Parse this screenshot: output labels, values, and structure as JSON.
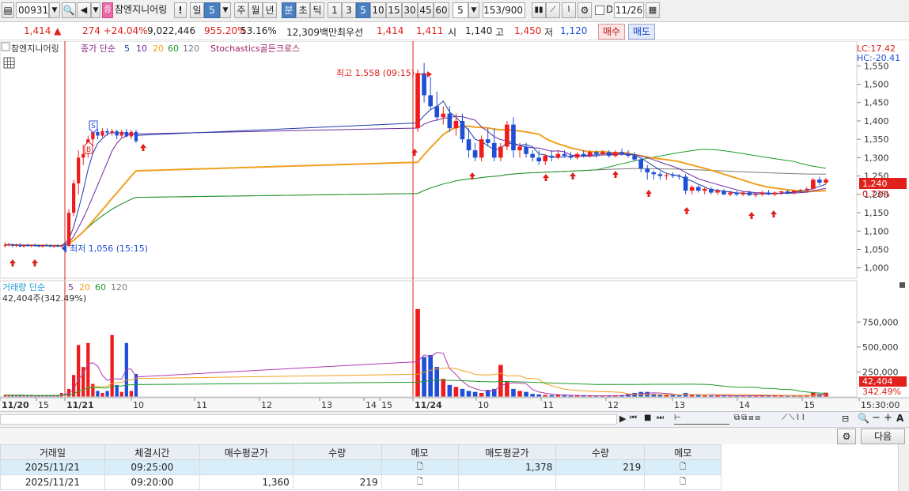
{
  "toolbar": {
    "code": "009310",
    "name": "참엔지니어링",
    "periods": [
      "일",
      "5",
      "주",
      "월",
      "년",
      "분",
      "초",
      "틱"
    ],
    "minutes": [
      "1",
      "3",
      "5",
      "10",
      "15",
      "30",
      "45",
      "60"
    ],
    "selected_minute": "5",
    "interval_value": "5",
    "count": "153",
    "count_total": "/900",
    "date": "11/26",
    "date_label": "D"
  },
  "quote": {
    "price": "1,414 ▲",
    "change": "274 +24.04%",
    "volume": "9,022,446",
    "vol_ratio": "955.20%",
    "turnover_ratio": "53.16%",
    "amount": "12,309백만",
    "best_label": "최우선",
    "ask": "1,414",
    "bid": "1,411",
    "open_label": "시",
    "open": "1,140",
    "high_label": "고",
    "high": "1,450",
    "low_label": "저",
    "low": "1,120",
    "buy_btn": "매수",
    "sell_btn": "매도"
  },
  "chart_legend": {
    "name": "참엔지니어링",
    "ma_label": "종가 단순",
    "ma": [
      "5",
      "10",
      "20",
      "60",
      "120"
    ],
    "signal": "Stochastics골든크로스",
    "lc": "LC:17.42",
    "hc": "HC:-20.41"
  },
  "chart_annotations": {
    "high": "최고 1,558 (09:15)",
    "low": "최저 1,056 (15:15)",
    "cur_price": "1,240",
    "cur_pct": "0.73%"
  },
  "vol_legend": {
    "label": "거래량 단순",
    "ma": [
      "5",
      "20",
      "60",
      "120"
    ],
    "current": "42,404주(342.49%)",
    "cur_val": "42,404",
    "cur_pct": "342.49%"
  },
  "colors": {
    "up": "#ee1c1c",
    "down": "#1f4fd6",
    "ma5": "#1b3fa8",
    "ma10": "#6b2aa0",
    "ma20": "#f0a020",
    "ma60": "#1f9a2a",
    "ma120": "#7a7a7a"
  },
  "chart_data": {
    "type": "candlestick",
    "price_axis": [
      "1,550",
      "1,500",
      "1,450",
      "1,400",
      "1,350",
      "1,300",
      "1,250",
      "1,200",
      "1,150",
      "1,100",
      "1,050",
      "1,000"
    ],
    "volume_axis": [
      "750,000",
      "500,000",
      "250,000"
    ],
    "time_axis": [
      "11/20",
      "15",
      "11/21",
      "10",
      "11",
      "12",
      "13",
      "14",
      "15",
      "11/24",
      "10",
      "11",
      "12",
      "13",
      "14",
      "15",
      "15:30:00"
    ],
    "ylim": [
      980,
      1570
    ],
    "vol_ylim": [
      0,
      950000
    ],
    "sessions": [
      {
        "date": "11/20",
        "bars": [
          [
            1060,
            1070,
            1055,
            1062,
            20000
          ],
          [
            1062,
            1068,
            1058,
            1064,
            15000
          ],
          [
            1064,
            1066,
            1056,
            1060,
            18000
          ],
          [
            1060,
            1066,
            1056,
            1062,
            12000
          ],
          [
            1062,
            1068,
            1056,
            1058,
            22000
          ],
          [
            1058,
            1064,
            1055,
            1062,
            14000
          ],
          [
            1062,
            1066,
            1058,
            1060,
            12000
          ],
          [
            1060,
            1064,
            1056,
            1062,
            15000
          ],
          [
            1062,
            1066,
            1058,
            1060,
            10000
          ],
          [
            1060,
            1064,
            1056,
            1058,
            12000
          ],
          [
            1058,
            1064,
            1055,
            1062,
            15000
          ],
          [
            1062,
            1066,
            1058,
            1060,
            14000
          ],
          [
            1060,
            1064,
            1056,
            1058,
            12000
          ],
          [
            1058,
            1062,
            1054,
            1060,
            15000
          ],
          [
            1060,
            1064,
            1056,
            1058,
            20000
          ],
          [
            1058,
            1062,
            1056,
            1060,
            40000
          ]
        ]
      },
      {
        "date": "11/21",
        "bars": [
          [
            1060,
            1160,
            1056,
            1150,
            80000
          ],
          [
            1150,
            1240,
            1140,
            1230,
            220000
          ],
          [
            1230,
            1320,
            1200,
            1300,
            520000
          ],
          [
            1300,
            1335,
            1280,
            1310,
            300000
          ],
          [
            1310,
            1360,
            1300,
            1350,
            540000
          ],
          [
            1350,
            1375,
            1330,
            1370,
            130000
          ],
          [
            1370,
            1378,
            1350,
            1360,
            60000
          ],
          [
            1360,
            1380,
            1355,
            1372,
            40000
          ],
          [
            1372,
            1380,
            1360,
            1368,
            60000
          ],
          [
            1368,
            1378,
            1360,
            1372,
            620000
          ],
          [
            1372,
            1376,
            1350,
            1360,
            120000
          ],
          [
            1360,
            1376,
            1355,
            1370,
            50000
          ],
          [
            1370,
            1378,
            1355,
            1358,
            540000
          ],
          [
            1358,
            1376,
            1350,
            1370,
            60000
          ],
          [
            1370,
            1376,
            1340,
            1345,
            230000
          ]
        ]
      },
      {
        "date": "11/24",
        "bars": [
          [
            1380,
            1540,
            1370,
            1530,
            880000
          ],
          [
            1530,
            1558,
            1450,
            1470,
            400000
          ],
          [
            1470,
            1520,
            1430,
            1440,
            420000
          ],
          [
            1440,
            1480,
            1400,
            1410,
            300000
          ],
          [
            1410,
            1440,
            1390,
            1420,
            180000
          ],
          [
            1420,
            1440,
            1370,
            1380,
            120000
          ],
          [
            1380,
            1420,
            1360,
            1400,
            100000
          ],
          [
            1400,
            1420,
            1340,
            1350,
            80000
          ],
          [
            1350,
            1380,
            1300,
            1320,
            60000
          ],
          [
            1320,
            1340,
            1290,
            1300,
            50000
          ],
          [
            1300,
            1360,
            1290,
            1350,
            40000
          ],
          [
            1350,
            1380,
            1330,
            1340,
            70000
          ],
          [
            1340,
            1380,
            1290,
            1300,
            80000
          ],
          [
            1300,
            1340,
            1290,
            1330,
            320000
          ],
          [
            1330,
            1400,
            1320,
            1390,
            150000
          ],
          [
            1390,
            1410,
            1300,
            1320,
            80000
          ],
          [
            1320,
            1340,
            1300,
            1330,
            60000
          ],
          [
            1330,
            1340,
            1300,
            1310,
            50000
          ],
          [
            1310,
            1320,
            1290,
            1300,
            30000
          ],
          [
            1300,
            1320,
            1280,
            1290,
            25000
          ],
          [
            1290,
            1310,
            1280,
            1305,
            20000
          ],
          [
            1305,
            1320,
            1290,
            1300,
            18000
          ],
          [
            1300,
            1320,
            1295,
            1310,
            20000
          ],
          [
            1310,
            1320,
            1300,
            1305,
            15000
          ],
          [
            1305,
            1315,
            1295,
            1300,
            12000
          ],
          [
            1300,
            1315,
            1295,
            1310,
            14000
          ],
          [
            1310,
            1320,
            1300,
            1305,
            12000
          ],
          [
            1305,
            1320,
            1300,
            1315,
            12000
          ],
          [
            1315,
            1320,
            1300,
            1310,
            10000
          ],
          [
            1310,
            1320,
            1305,
            1315,
            12000
          ],
          [
            1315,
            1320,
            1300,
            1305,
            14000
          ],
          [
            1305,
            1320,
            1300,
            1315,
            16000
          ],
          [
            1315,
            1325,
            1305,
            1310,
            18000
          ],
          [
            1310,
            1320,
            1300,
            1305,
            30000
          ],
          [
            1305,
            1315,
            1290,
            1295,
            40000
          ],
          [
            1295,
            1300,
            1260,
            1270,
            50000
          ],
          [
            1270,
            1280,
            1240,
            1260,
            50000
          ],
          [
            1260,
            1265,
            1240,
            1255,
            30000
          ],
          [
            1255,
            1262,
            1240,
            1250,
            25000
          ],
          [
            1250,
            1258,
            1240,
            1252,
            20000
          ],
          [
            1252,
            1260,
            1245,
            1250,
            18000
          ],
          [
            1250,
            1255,
            1240,
            1248,
            15000
          ],
          [
            1248,
            1255,
            1200,
            1210,
            40000
          ],
          [
            1210,
            1225,
            1200,
            1220,
            20000
          ],
          [
            1220,
            1225,
            1205,
            1210,
            18000
          ],
          [
            1210,
            1220,
            1200,
            1215,
            15000
          ],
          [
            1215,
            1220,
            1200,
            1205,
            14000
          ],
          [
            1205,
            1215,
            1198,
            1210,
            12000
          ],
          [
            1210,
            1215,
            1198,
            1200,
            12000
          ],
          [
            1200,
            1210,
            1195,
            1205,
            12000
          ],
          [
            1205,
            1210,
            1195,
            1200,
            10000
          ],
          [
            1200,
            1208,
            1195,
            1205,
            12000
          ],
          [
            1205,
            1210,
            1195,
            1198,
            14000
          ],
          [
            1198,
            1205,
            1192,
            1200,
            12000
          ],
          [
            1200,
            1210,
            1195,
            1205,
            14000
          ],
          [
            1205,
            1212,
            1198,
            1200,
            16000
          ],
          [
            1200,
            1208,
            1195,
            1205,
            12000
          ],
          [
            1205,
            1210,
            1198,
            1208,
            14000
          ],
          [
            1208,
            1212,
            1200,
            1205,
            10000
          ],
          [
            1205,
            1212,
            1200,
            1210,
            12000
          ],
          [
            1210,
            1215,
            1205,
            1212,
            14000
          ],
          [
            1212,
            1220,
            1205,
            1215,
            20000
          ],
          [
            1215,
            1245,
            1210,
            1240,
            40000
          ],
          [
            1240,
            1248,
            1225,
            1232,
            30000
          ],
          [
            1232,
            1245,
            1228,
            1240,
            42404
          ]
        ]
      }
    ]
  },
  "bottom": {
    "settings_icon": "gear-icon",
    "next_btn": "다음"
  },
  "grid": {
    "headers": [
      "거래일",
      "체결시간",
      "매수평균가",
      "수량",
      "메모",
      "매도평균가",
      "수량",
      "메모"
    ],
    "rows": [
      [
        "2025/11/21",
        "09:25:00",
        "",
        "",
        "",
        "1,378",
        "219",
        ""
      ],
      [
        "2025/11/21",
        "09:20:00",
        "1,360",
        "219",
        "",
        "",
        "",
        ""
      ]
    ]
  }
}
